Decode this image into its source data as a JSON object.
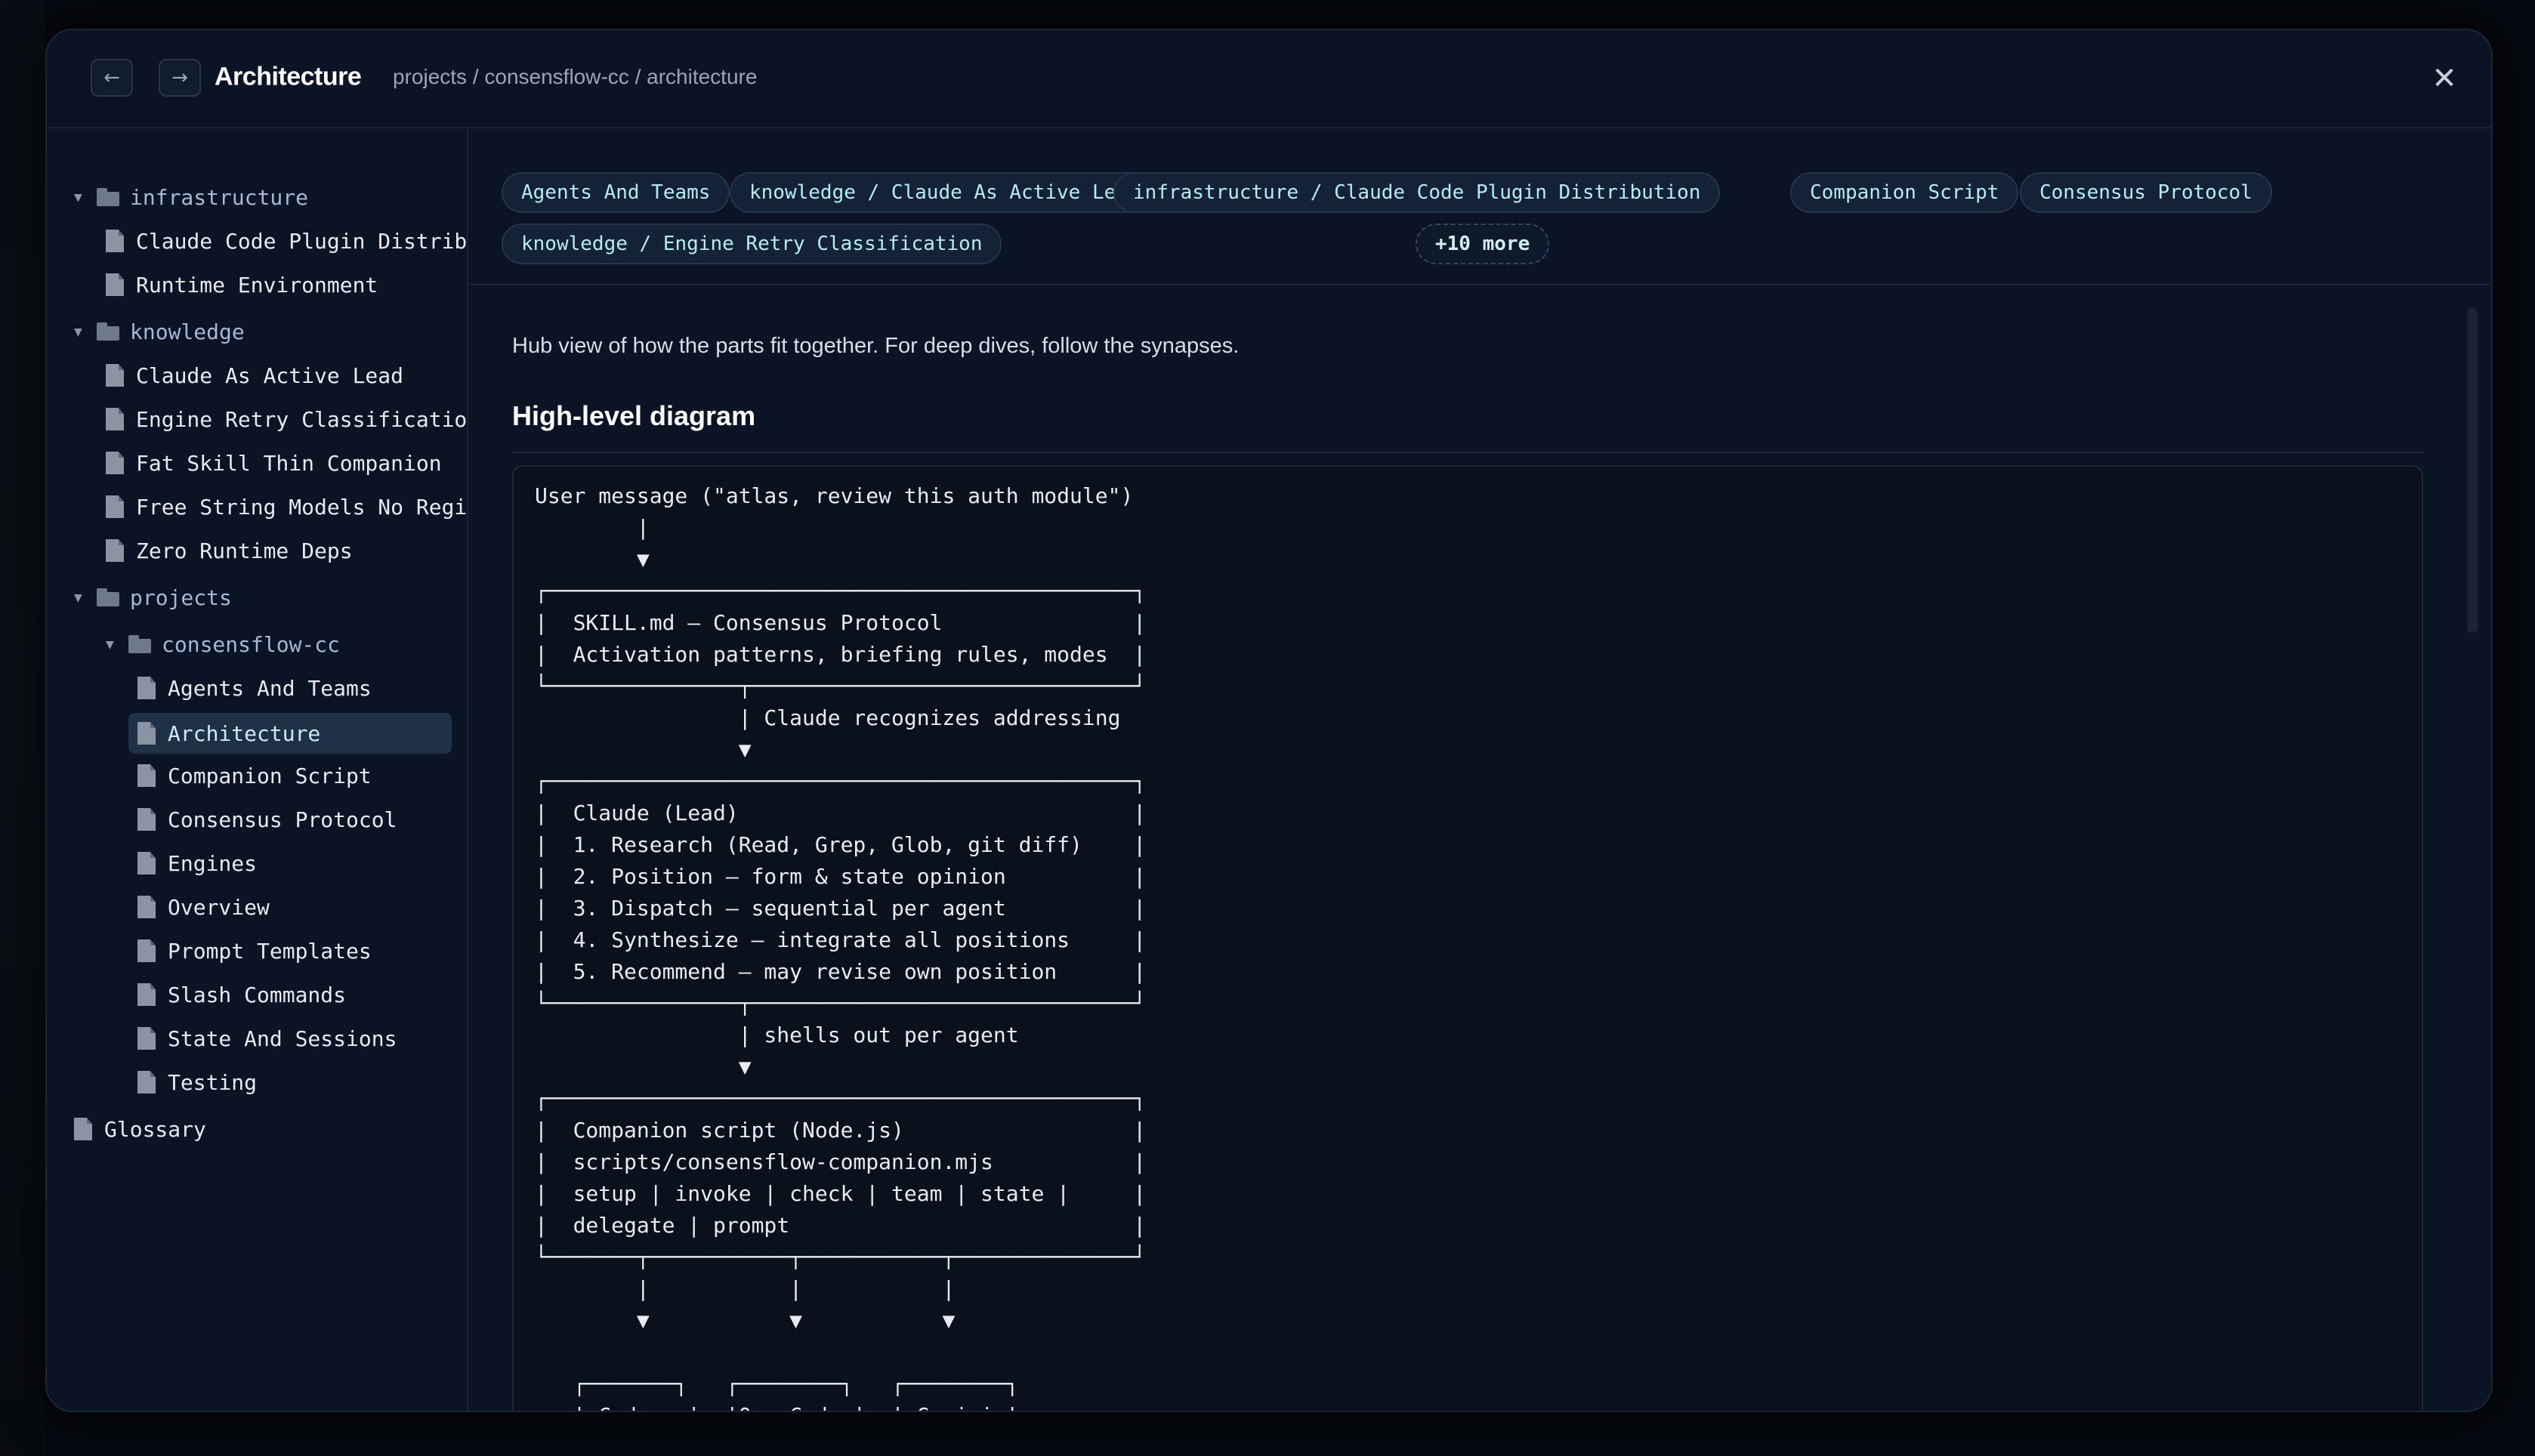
{
  "header": {
    "title": "Architecture",
    "breadcrumb": "projects / consensflow-cc / architecture",
    "back_icon": "←",
    "forward_icon": "→",
    "close_icon": "✕"
  },
  "sidebar": {
    "tree": [
      {
        "type": "folder",
        "label": "infrastructure",
        "expanded": true
      },
      {
        "type": "file",
        "label": "Claude Code Plugin Distrib"
      },
      {
        "type": "file",
        "label": "Runtime Environment"
      },
      {
        "type": "folder",
        "label": "knowledge",
        "expanded": true
      },
      {
        "type": "file",
        "label": "Claude As Active Lead"
      },
      {
        "type": "file",
        "label": "Engine Retry Classificatio"
      },
      {
        "type": "file",
        "label": "Fat Skill Thin Companion"
      },
      {
        "type": "file",
        "label": "Free String Models No Regi"
      },
      {
        "type": "file",
        "label": "Zero Runtime Deps"
      },
      {
        "type": "folder",
        "label": "projects",
        "expanded": true
      },
      {
        "type": "folder",
        "label": "consensflow-cc",
        "expanded": true
      },
      {
        "type": "file",
        "label": "Agents And Teams"
      },
      {
        "type": "file",
        "label": "Architecture",
        "active": true
      },
      {
        "type": "file",
        "label": "Companion Script"
      },
      {
        "type": "file",
        "label": "Consensus Protocol"
      },
      {
        "type": "file",
        "label": "Engines"
      },
      {
        "type": "file",
        "label": "Overview"
      },
      {
        "type": "file",
        "label": "Prompt Templates"
      },
      {
        "type": "file",
        "label": "Slash Commands"
      },
      {
        "type": "file",
        "label": "State And Sessions"
      },
      {
        "type": "file",
        "label": "Testing"
      },
      {
        "type": "file",
        "label": "Glossary"
      }
    ]
  },
  "tags": [
    "Agents And Teams",
    "knowledge / Claude As Active Lead",
    "infrastructure / Claude Code Plugin Distribution",
    "Companion Script",
    "Consensus Protocol",
    "knowledge / Engine Retry Classification",
    "+10 more"
  ],
  "content": {
    "intro": "Hub view of how the parts fit together. For deep dives, follow the synapses.",
    "heading": "High-level diagram",
    "diagram": "User message (\"atlas, review this auth module\")\n        |\n        ▼\n┌──────────────────────────────────────────────┐\n|  SKILL.md — Consensus Protocol               |\n|  Activation patterns, briefing rules, modes  |\n└───────────────┬──────────────────────────────┘\n                | Claude recognizes addressing\n                ▼\n┌──────────────────────────────────────────────┐\n|  Claude (Lead)                               |\n|  1. Research (Read, Grep, Glob, git diff)    |\n|  2. Position — form & state opinion          |\n|  3. Dispatch — sequential per agent          |\n|  4. Synthesize — integrate all positions     |\n|  5. Recommend — may revise own position      |\n└───────────────┬──────────────────────────────┘\n                | shells out per agent\n                ▼\n┌──────────────────────────────────────────────┐\n|  Companion script (Node.js)                  |\n|  scripts/consensflow-companion.mjs           |\n|  setup | invoke | check | team | state |     |\n|  delegate | prompt                           |\n└───────┬───────────┬───────────┬──────────────┘\n        |           |           |\n        ▼           ▼           ▼\n\n   ┌───────┐   ┌────────┐   ┌────────┐\n   | Codex  |  |OpenCode |  | Gemini |\n   |  exec  |  |  run    |  |  -p    |"
  }
}
